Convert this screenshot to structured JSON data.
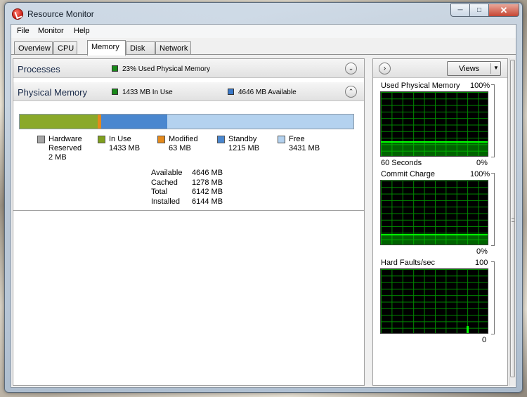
{
  "window": {
    "title": "Resource Monitor",
    "minimize_glyph": "─",
    "maximize_glyph": "□",
    "close_glyph": "✕"
  },
  "menu": [
    "File",
    "Monitor",
    "Help"
  ],
  "tabs": [
    {
      "label": "Overview",
      "active": false
    },
    {
      "label": "CPU",
      "active": false
    },
    {
      "label": "Memory",
      "active": true
    },
    {
      "label": "Disk",
      "active": false
    },
    {
      "label": "Network",
      "active": false
    }
  ],
  "processes": {
    "title": "Processes",
    "indicator": "23% Used Physical Memory",
    "indicator_color": "#1a8a1a",
    "expander": "⌄"
  },
  "physical_memory": {
    "title": "Physical Memory",
    "in_use_indicator": "1433 MB In Use",
    "available_indicator": "4646 MB Available",
    "in_use_color": "#1a8a1a",
    "available_color": "#3a78c8",
    "collapser": "⌃",
    "bar_segments_mb": [
      {
        "name": "Hardware Reserved",
        "mb": 2,
        "color": "#a6a6a6"
      },
      {
        "name": "In Use",
        "mb": 1433,
        "color": "#8aa92a"
      },
      {
        "name": "Modified",
        "mb": 63,
        "color": "#e58a1c"
      },
      {
        "name": "Standby",
        "mb": 1215,
        "color": "#4a87cf"
      },
      {
        "name": "Free",
        "mb": 3431,
        "color": "#b4d2ef"
      }
    ],
    "legend": [
      {
        "label": "Hardware",
        "label2": "Reserved",
        "value": "2 MB",
        "color": "#a6a6a6"
      },
      {
        "label": "In Use",
        "label2": "",
        "value": "1433 MB",
        "color": "#7fa01e"
      },
      {
        "label": "Modified",
        "label2": "",
        "value": "63 MB",
        "color": "#e58a1c"
      },
      {
        "label": "Standby",
        "label2": "",
        "value": "1215 MB",
        "color": "#4a87cf"
      },
      {
        "label": "Free",
        "label2": "",
        "value": "3431 MB",
        "color": "#b4d2ef"
      }
    ],
    "summary": [
      {
        "label": "Available",
        "value": "4646 MB"
      },
      {
        "label": "Cached",
        "value": "1278 MB"
      },
      {
        "label": "Total",
        "value": "6142 MB"
      },
      {
        "label": "Installed",
        "value": "6144 MB"
      }
    ]
  },
  "right_pane": {
    "expand_glyph": "›",
    "views_label": "Views",
    "views_caret": "▼",
    "graphs": [
      {
        "title": "Used Physical Memory",
        "max": "100%",
        "min": "0%",
        "footer": "60 Seconds",
        "fill_fraction": 0.23
      },
      {
        "title": "Commit Charge",
        "max": "100%",
        "min": "0%",
        "footer": "",
        "fill_fraction": 0.17
      },
      {
        "title": "Hard Faults/sec",
        "max": "100",
        "min": "0",
        "footer": "",
        "fill_fraction": 0.0
      }
    ]
  }
}
